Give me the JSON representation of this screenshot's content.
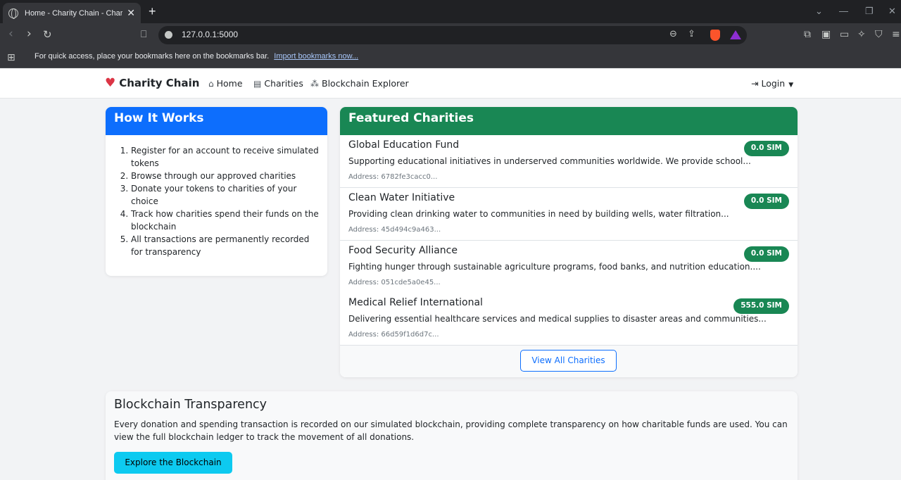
{
  "browser": {
    "tab_title": "Home - Charity Chain - Charity",
    "url": "127.0.0.1:5000",
    "bookmarks_message": "For quick access, place your bookmarks here on the bookmarks bar.",
    "import_bookmarks": "Import bookmarks now..."
  },
  "nav": {
    "brand": "Charity Chain",
    "links": [
      {
        "label": "Home",
        "icon": "home-icon"
      },
      {
        "label": "Charities",
        "icon": "building-icon"
      },
      {
        "label": "Blockchain Explorer",
        "icon": "diagram-icon"
      }
    ],
    "login": "Login"
  },
  "how_it_works": {
    "title": "How It Works",
    "steps": [
      "Register for an account to receive simulated tokens",
      "Browse through our approved charities",
      "Donate your tokens to charities of your choice",
      "Track how charities spend their funds on the blockchain",
      "All transactions are permanently recorded for transparency"
    ]
  },
  "featured": {
    "title": "Featured Charities",
    "charities": [
      {
        "name": "Global Education Fund",
        "description": "Supporting educational initiatives in underserved communities worldwide. We provide school...",
        "address": "Address: 6782fe3cacc0...",
        "balance": "0.0 SIM"
      },
      {
        "name": "Clean Water Initiative",
        "description": "Providing clean drinking water to communities in need by building wells, water filtration...",
        "address": "Address: 45d494c9a463...",
        "balance": "0.0 SIM"
      },
      {
        "name": "Food Security Alliance",
        "description": "Fighting hunger through sustainable agriculture programs, food banks, and nutrition education....",
        "address": "Address: 051cde5a0e45...",
        "balance": "0.0 SIM"
      },
      {
        "name": "Medical Relief International",
        "description": "Delivering essential healthcare services and medical supplies to disaster areas and communities...",
        "address": "Address: 66d59f1d6d7c...",
        "balance": "555.0 SIM"
      }
    ],
    "view_all": "View All Charities"
  },
  "transparency": {
    "title": "Blockchain Transparency",
    "text": "Every donation and spending transaction is recorded on our simulated blockchain, providing complete transparency on how charitable funds are used. You can view the full blockchain ledger to track the movement of all donations.",
    "button": "Explore the Blockchain"
  },
  "colors": {
    "primary": "#0d6efd",
    "success": "#198754",
    "info": "#0dcaf0",
    "danger": "#dc3545"
  }
}
